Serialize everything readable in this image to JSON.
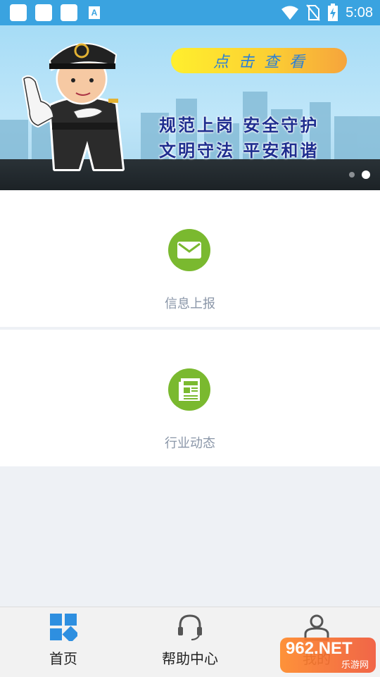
{
  "status_bar": {
    "time": "5:08",
    "left_icons": [
      "notification-square-icon",
      "notification-square-icon",
      "notification-square-icon",
      "app-a-icon"
    ],
    "app_a_letter": "A",
    "right_icons": [
      "wifi-icon",
      "no-sim-icon",
      "battery-charging-icon"
    ],
    "color": "#3aa3e0"
  },
  "banner": {
    "button_label": "点击查看",
    "slogan_line1": "规范上岗 安全守护",
    "slogan_line2": "文明守法 平安和谐",
    "slide_count": 2,
    "active_slide": 2
  },
  "cards": [
    {
      "label": "信息上报",
      "icon": "envelope-icon"
    },
    {
      "label": "行业动态",
      "icon": "news-icon"
    }
  ],
  "accent_color": "#7ab92f",
  "tabbar": {
    "tabs": [
      {
        "label": "首页",
        "icon": "home-grid-icon",
        "active": true
      },
      {
        "label": "帮助中心",
        "icon": "headset-icon",
        "active": false
      },
      {
        "label": "我的",
        "icon": "person-icon",
        "active": false
      }
    ]
  },
  "watermark": {
    "top": "962.NET",
    "bottom": "乐游网"
  }
}
